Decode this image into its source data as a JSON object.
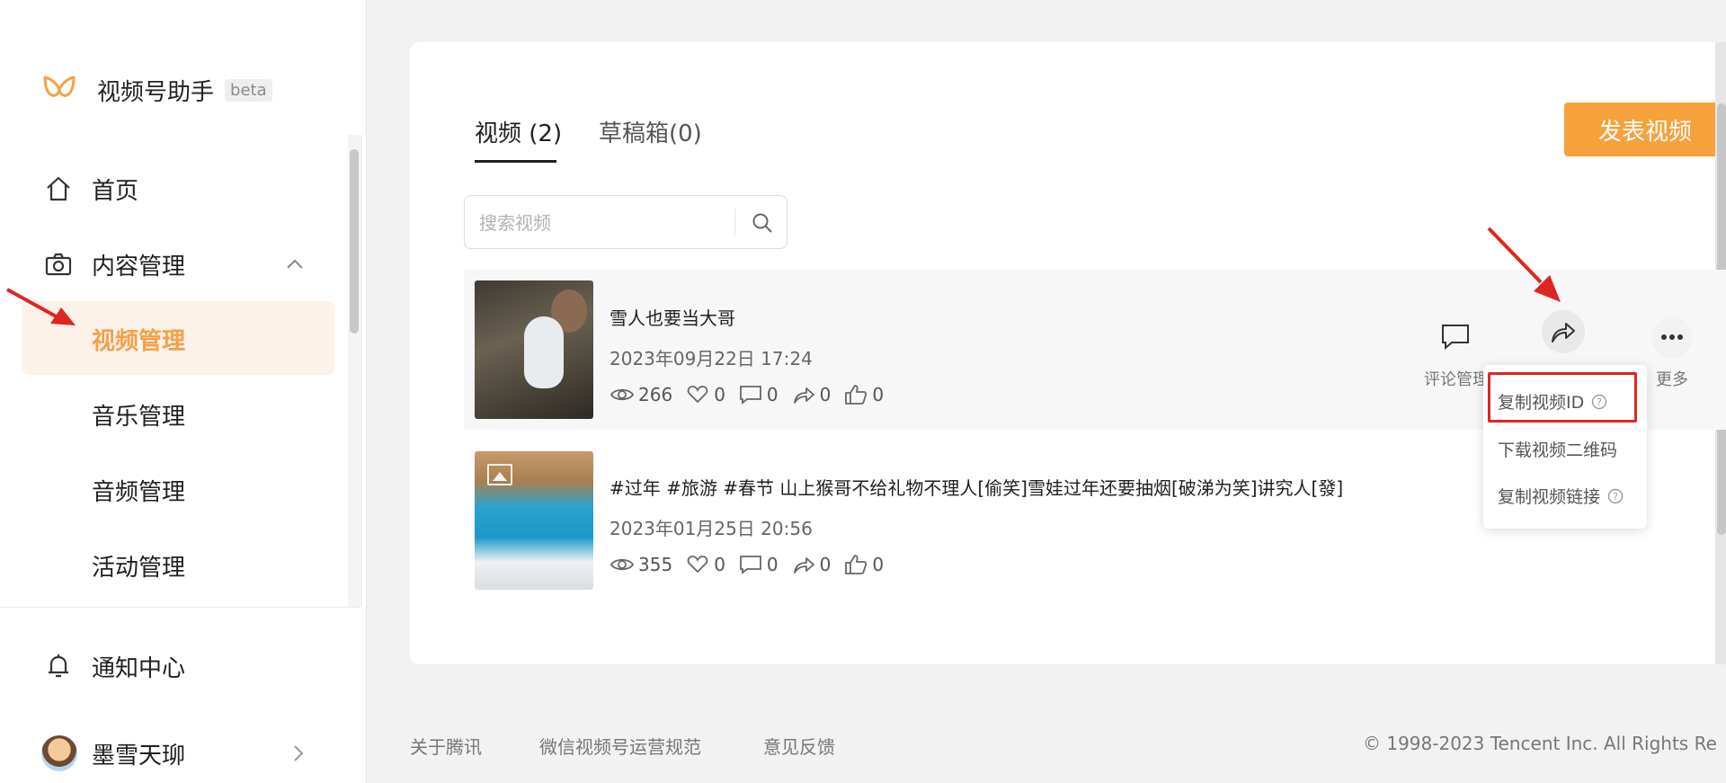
{
  "app": {
    "name": "视频号助手",
    "badge": "beta"
  },
  "sidebar": {
    "home": "首页",
    "content": "内容管理",
    "sub_items": [
      "视频管理",
      "音乐管理",
      "音频管理",
      "活动管理"
    ],
    "notifications": "通知中心",
    "user_name": "墨雪天珋"
  },
  "tabs": {
    "videos": "视频 (2)",
    "drafts": "草稿箱(0)"
  },
  "publish_button": "发表视频",
  "search": {
    "placeholder": "搜索视频",
    "value": ""
  },
  "videos": [
    {
      "title": "雪人也要当大哥",
      "date": "2023年09月22日 17:24",
      "views": "266",
      "likes": "0",
      "comments": "0",
      "shares": "0",
      "thumbs": "0"
    },
    {
      "title": "#过年 #旅游 #春节 山上猴哥不给礼物不理人[偷笑]雪娃过年还要抽烟[破涕为笑]讲究人[發]",
      "date": "2023年01月25日 20:56",
      "views": "355",
      "likes": "0",
      "comments": "0",
      "shares": "0",
      "thumbs": "0"
    }
  ],
  "actions": {
    "comment_manage": "评论管理",
    "more": "更多"
  },
  "share_menu": [
    "复制视频ID",
    "下载视频二维码",
    "复制视频链接"
  ],
  "footer": {
    "about": "关于腾讯",
    "rules": "微信视频号运营规范",
    "feedback": "意见反馈",
    "copyright": "© 1998-2023 Tencent Inc. All Rights Re"
  },
  "colors": {
    "accent": "#f5a23d",
    "active_bg": "#fdf2e7",
    "annotation": "#e02424"
  }
}
